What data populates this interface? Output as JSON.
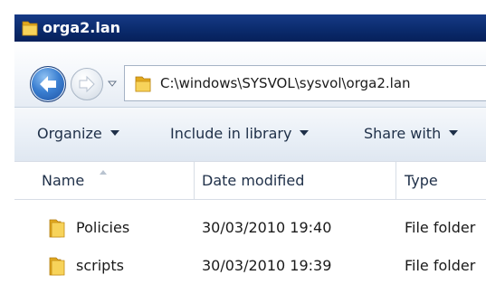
{
  "window": {
    "title": "orga2.lan",
    "title_bar_color": "#0a2a6b"
  },
  "navigation": {
    "back_icon": "back-arrow-icon",
    "forward_icon": "forward-arrow-icon",
    "address_path": "C:\\windows\\SYSVOL\\sysvol\\orga2.lan"
  },
  "toolbar": {
    "organize_label": "Organize",
    "include_library_label": "Include in library",
    "share_with_label": "Share with"
  },
  "columns": {
    "name": "Name",
    "date_modified": "Date modified",
    "type": "Type"
  },
  "files": [
    {
      "name": "Policies",
      "date_modified": "30/03/2010 19:40",
      "type": "File folder"
    },
    {
      "name": "scripts",
      "date_modified": "30/03/2010 19:39",
      "type": "File folder"
    }
  ]
}
